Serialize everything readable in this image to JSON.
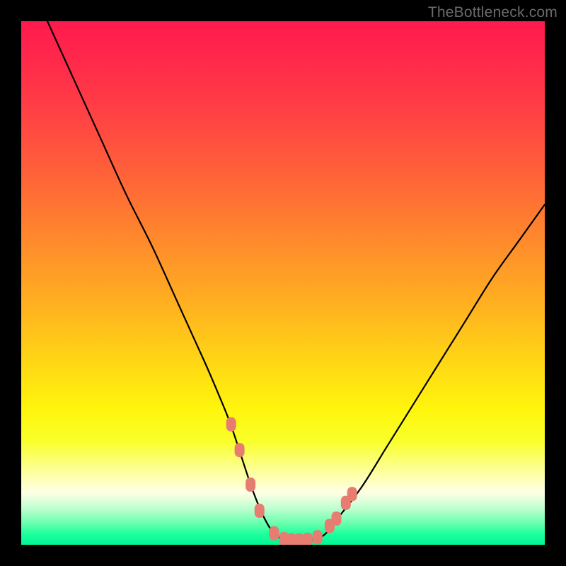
{
  "watermark": "TheBottleneck.com",
  "chart_data": {
    "type": "line",
    "title": "",
    "xlabel": "",
    "ylabel": "",
    "xlim": [
      0,
      100
    ],
    "ylim": [
      0,
      100
    ],
    "grid": false,
    "legend": false,
    "series": [
      {
        "name": "curve",
        "x": [
          5,
          10,
          15,
          20,
          25,
          30,
          35,
          38,
          40,
          42,
          44,
          46,
          48,
          50,
          52,
          54,
          56,
          58,
          60,
          65,
          70,
          75,
          80,
          85,
          90,
          95,
          100
        ],
        "y": [
          100,
          89,
          78,
          67,
          57,
          46,
          35,
          28,
          23,
          17,
          11,
          6,
          2.5,
          1,
          0.7,
          0.7,
          1,
          2,
          4.5,
          11,
          19,
          27,
          35,
          43,
          51,
          58,
          65
        ]
      }
    ],
    "markers": [
      {
        "x": 40.1,
        "y": 23.0
      },
      {
        "x": 41.7,
        "y": 18.1
      },
      {
        "x": 43.8,
        "y": 11.5
      },
      {
        "x": 45.5,
        "y": 6.5
      },
      {
        "x": 48.3,
        "y": 2.2
      },
      {
        "x": 50.2,
        "y": 1.1
      },
      {
        "x": 51.6,
        "y": 0.85
      },
      {
        "x": 53.1,
        "y": 0.82
      },
      {
        "x": 54.7,
        "y": 0.95
      },
      {
        "x": 56.6,
        "y": 1.45
      },
      {
        "x": 58.9,
        "y": 3.6
      },
      {
        "x": 60.2,
        "y": 5.0
      },
      {
        "x": 62.0,
        "y": 8.0
      },
      {
        "x": 63.2,
        "y": 9.7
      }
    ],
    "gradient_stops": [
      {
        "pos": 0,
        "color": "#ff1a4d"
      },
      {
        "pos": 30,
        "color": "#ff6438"
      },
      {
        "pos": 64,
        "color": "#ffd316"
      },
      {
        "pos": 90,
        "color": "#ffffe6"
      },
      {
        "pos": 100,
        "color": "#00f795"
      }
    ]
  }
}
